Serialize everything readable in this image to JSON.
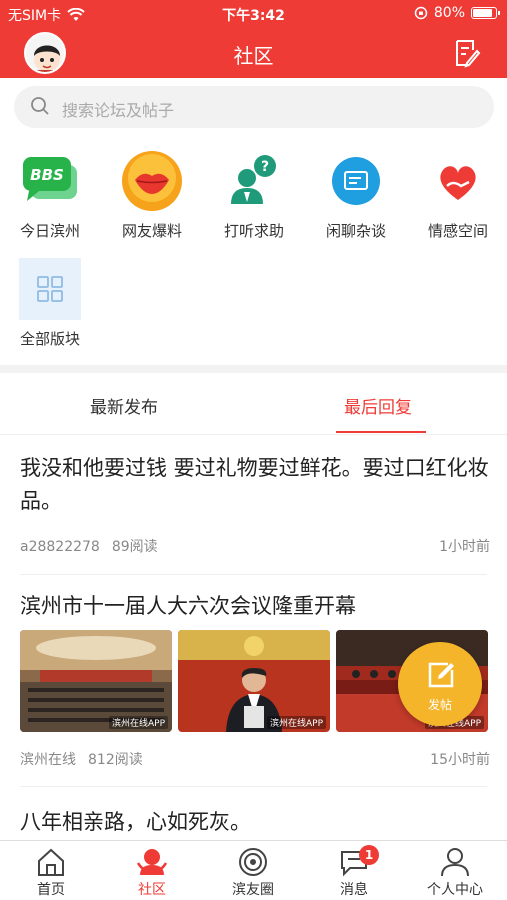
{
  "status_bar": {
    "carrier": "无SIM卡",
    "time": "下午3:42",
    "battery": "80%",
    "battery_level": 0.8
  },
  "header": {
    "title": "社区"
  },
  "search": {
    "placeholder": "搜索论坛及帖子"
  },
  "forums": [
    {
      "label": "今日滨州",
      "icon": "bbs-icon"
    },
    {
      "label": "网友爆料",
      "icon": "lips-icon"
    },
    {
      "label": "打听求助",
      "icon": "help-person-icon"
    },
    {
      "label": "闲聊杂谈",
      "icon": "chat-icon"
    },
    {
      "label": "情感空间",
      "icon": "heart-hand-icon"
    },
    {
      "label": "全部版块",
      "icon": "grid-icon"
    }
  ],
  "bbs_text": "BBS",
  "tabs": {
    "latest": "最新发布",
    "last_reply": "最后回复",
    "active": "last_reply"
  },
  "posts": [
    {
      "title": "我没和他要过钱 要过礼物要过鲜花。要过口红化妆品。",
      "author": "a28822278",
      "reads": "89阅读",
      "time": "1小时前"
    },
    {
      "title": "滨州市十一届人大六次会议隆重开幕",
      "author": "滨州在线",
      "reads": "812阅读",
      "time": "15小时前",
      "image_watermark": "滨州在线APP"
    },
    {
      "title": "八年相亲路，心如死灰。"
    }
  ],
  "fab": {
    "label": "发帖"
  },
  "tabbar": [
    {
      "label": "首页",
      "icon": "home-icon"
    },
    {
      "label": "社区",
      "icon": "community-icon"
    },
    {
      "label": "滨友圈",
      "icon": "circle-icon"
    },
    {
      "label": "消息",
      "icon": "message-icon",
      "badge": "1"
    },
    {
      "label": "个人中心",
      "icon": "user-icon"
    }
  ],
  "colors": {
    "brand": "#ef3b36",
    "fab": "#f5b52b"
  }
}
